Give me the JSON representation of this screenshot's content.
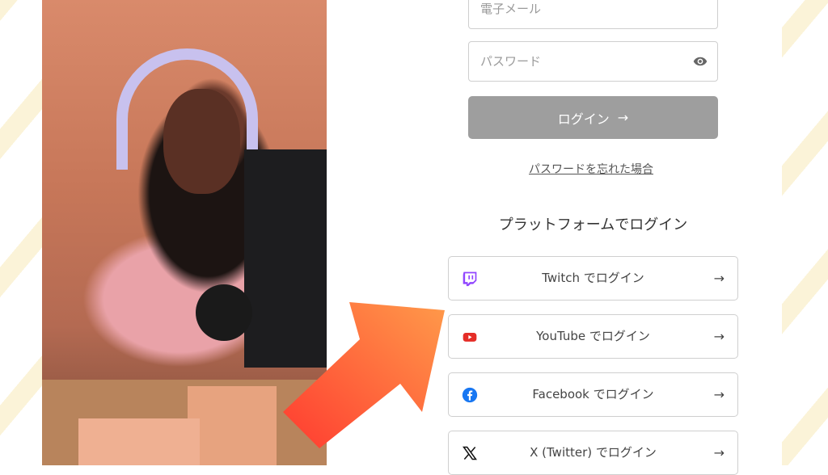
{
  "form": {
    "email_placeholder": "電子メール",
    "password_placeholder": "パスワード",
    "login_button": "ログイン",
    "forgot_password": "パスワードを忘れた場合"
  },
  "platform_section": {
    "title": "プラットフォームでログイン",
    "buttons": [
      {
        "label": "Twitch でログイン",
        "icon": "twitch-icon",
        "color": "#9146ff"
      },
      {
        "label": "YouTube でログイン",
        "icon": "youtube-icon",
        "color": "#e52d27"
      },
      {
        "label": "Facebook でログイン",
        "icon": "facebook-icon",
        "color": "#1877f2"
      },
      {
        "label": "X (Twitter) でログイン",
        "icon": "x-icon",
        "color": "#111111"
      }
    ]
  },
  "colors": {
    "login_button_bg": "#9e9e9e",
    "arrow_gradient_start": "#ff9a4a",
    "arrow_gradient_end": "#ff3b30"
  }
}
